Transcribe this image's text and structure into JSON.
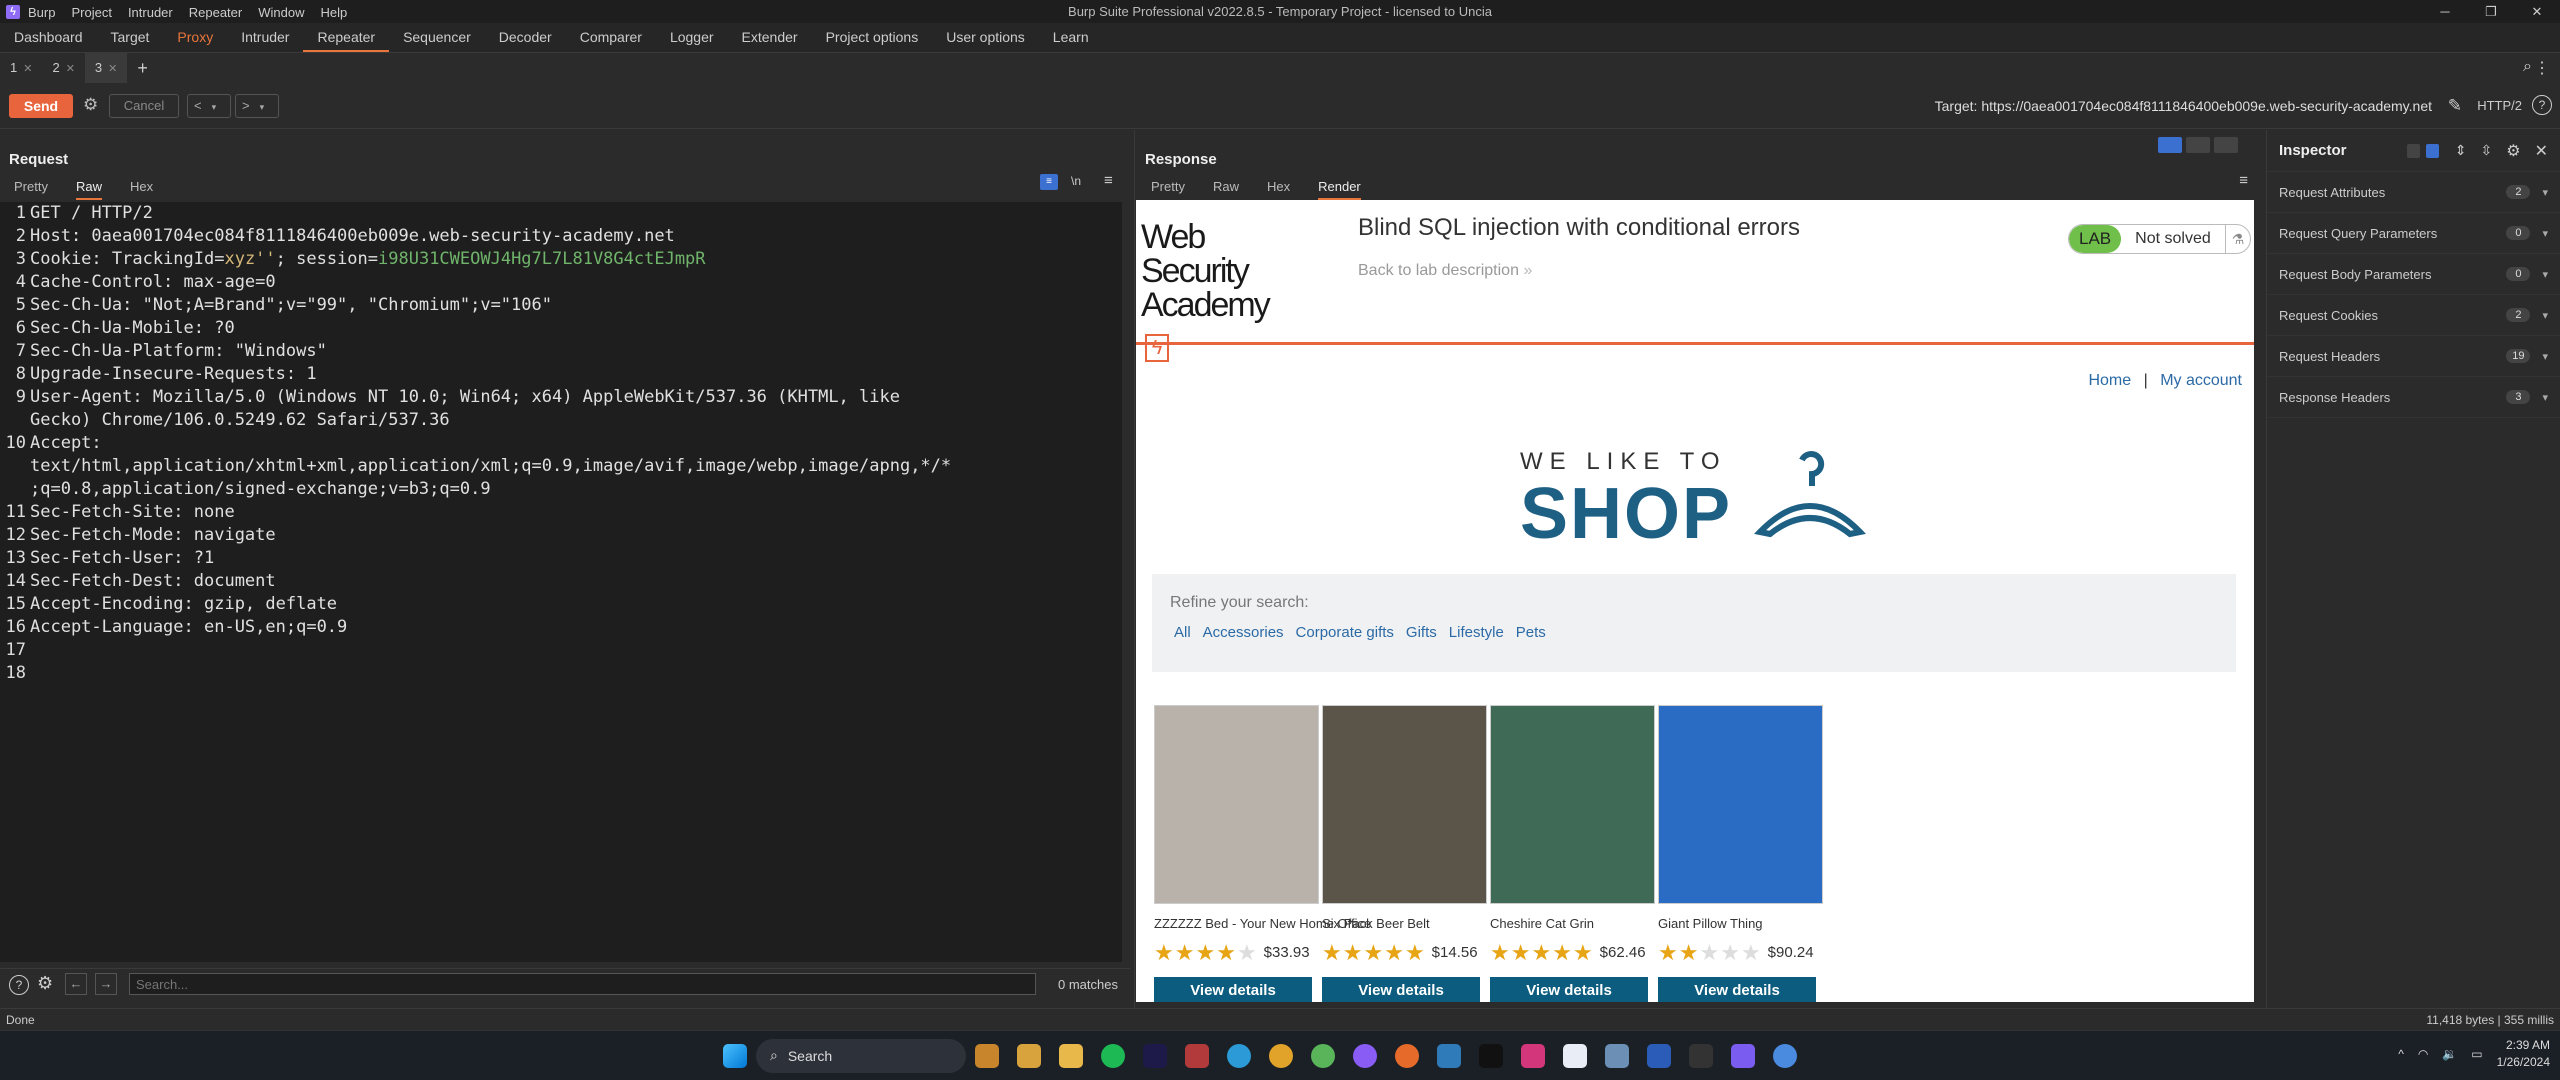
{
  "window": {
    "title": "Burp Suite Professional v2022.8.5 - Temporary Project - licensed to Uncia",
    "menu": [
      "Burp",
      "Project",
      "Intruder",
      "Repeater",
      "Window",
      "Help"
    ]
  },
  "tool_tabs": [
    "Dashboard",
    "Target",
    "Proxy",
    "Intruder",
    "Repeater",
    "Sequencer",
    "Decoder",
    "Comparer",
    "Logger",
    "Extender",
    "Project options",
    "User options",
    "Learn"
  ],
  "repeater_tabs": [
    {
      "label": "1"
    },
    {
      "label": "2"
    },
    {
      "label": "3"
    }
  ],
  "toolbar": {
    "send": "Send",
    "cancel": "Cancel",
    "back": "<",
    "forward": ">",
    "target": "Target: https://0aea001704ec084f8111846400eb009e.web-security-academy.net",
    "protocol": "HTTP/2"
  },
  "request": {
    "title": "Request",
    "tabs": [
      "Pretty",
      "Raw",
      "Hex"
    ],
    "newline_toggle": "\\n",
    "lines": [
      {
        "n": "1",
        "parts": [
          [
            "k",
            "GET / HTTP/2"
          ]
        ]
      },
      {
        "n": "2",
        "parts": [
          [
            "k",
            "Host: 0aea001704ec084f8111846400eb009e.web-security-academy.net"
          ]
        ]
      },
      {
        "n": "3",
        "parts": [
          [
            "k",
            "Cookie: TrackingId="
          ],
          [
            "hl",
            "xyz''"
          ],
          [
            "k",
            "; session="
          ],
          [
            "ck",
            "i98U31CWEOWJ4Hg7L7L81V8G4ctEJmpR"
          ]
        ]
      },
      {
        "n": "4",
        "parts": [
          [
            "k",
            "Cache-Control: max-age=0"
          ]
        ]
      },
      {
        "n": "5",
        "parts": [
          [
            "k",
            "Sec-Ch-Ua: \"Not;A=Brand\";v=\"99\", \"Chromium\";v=\"106\""
          ]
        ]
      },
      {
        "n": "6",
        "parts": [
          [
            "k",
            "Sec-Ch-Ua-Mobile: ?0"
          ]
        ]
      },
      {
        "n": "7",
        "parts": [
          [
            "k",
            "Sec-Ch-Ua-Platform: \"Windows\""
          ]
        ]
      },
      {
        "n": "8",
        "parts": [
          [
            "k",
            "Upgrade-Insecure-Requests: 1"
          ]
        ]
      },
      {
        "n": "9",
        "parts": [
          [
            "k",
            "User-Agent: Mozilla/5.0 (Windows NT 10.0; Win64; x64) AppleWebKit/537.36 (KHTML, like"
          ]
        ]
      },
      {
        "n": "",
        "parts": [
          [
            "k",
            "Gecko) Chrome/106.0.5249.62 Safari/537.36"
          ]
        ]
      },
      {
        "n": "10",
        "parts": [
          [
            "k",
            "Accept:"
          ]
        ]
      },
      {
        "n": "",
        "parts": [
          [
            "k",
            "text/html,application/xhtml+xml,application/xml;q=0.9,image/avif,image/webp,image/apng,*/*"
          ]
        ]
      },
      {
        "n": "",
        "parts": [
          [
            "k",
            ";q=0.8,application/signed-exchange;v=b3;q=0.9"
          ]
        ]
      },
      {
        "n": "11",
        "parts": [
          [
            "k",
            "Sec-Fetch-Site: none"
          ]
        ]
      },
      {
        "n": "12",
        "parts": [
          [
            "k",
            "Sec-Fetch-Mode: navigate"
          ]
        ]
      },
      {
        "n": "13",
        "parts": [
          [
            "k",
            "Sec-Fetch-User: ?1"
          ]
        ]
      },
      {
        "n": "14",
        "parts": [
          [
            "k",
            "Sec-Fetch-Dest: document"
          ]
        ]
      },
      {
        "n": "15",
        "parts": [
          [
            "k",
            "Accept-Encoding: gzip, deflate"
          ]
        ]
      },
      {
        "n": "16",
        "parts": [
          [
            "k",
            "Accept-Language: en-US,en;q=0.9"
          ]
        ]
      },
      {
        "n": "17",
        "parts": []
      },
      {
        "n": "18",
        "parts": []
      }
    ],
    "search_placeholder": "Search...",
    "matches": "0 matches"
  },
  "response": {
    "title": "Response",
    "tabs": [
      "Pretty",
      "Raw",
      "Hex",
      "Render"
    ]
  },
  "page": {
    "logo_line1": "Web Security",
    "logo_line2": "Academy",
    "lab_title": "Blind SQL injection with conditional errors",
    "back_link": "Back to lab description",
    "lab_badge": "LAB",
    "lab_status": "Not solved",
    "nav_home": "Home",
    "nav_sep": "|",
    "nav_account": "My account",
    "shop_top": "WE LIKE TO",
    "shop_big": "SHOP",
    "refine": "Refine your search:",
    "categories": [
      "All",
      "Accessories",
      "Corporate gifts",
      "Gifts",
      "Lifestyle",
      "Pets"
    ],
    "products": [
      {
        "name": "ZZZZZZ Bed - Your New Home Office",
        "rating": 4,
        "price": "$33.93",
        "button": "View details",
        "color": "#b8b2ab"
      },
      {
        "name": "Six Pack Beer Belt",
        "rating": 5,
        "price": "$14.56",
        "button": "View details",
        "color": "#5a5548"
      },
      {
        "name": "Cheshire Cat Grin",
        "rating": 5,
        "price": "$62.46",
        "button": "View details",
        "color": "#3f6a56"
      },
      {
        "name": "Giant Pillow Thing",
        "rating": 2,
        "price": "$90.24",
        "button": "View details",
        "color": "#2a6bc4"
      }
    ]
  },
  "inspector": {
    "title": "Inspector",
    "rows": [
      {
        "label": "Request Attributes",
        "count": "2"
      },
      {
        "label": "Request Query Parameters",
        "count": "0"
      },
      {
        "label": "Request Body Parameters",
        "count": "0"
      },
      {
        "label": "Request Cookies",
        "count": "2"
      },
      {
        "label": "Request Headers",
        "count": "19"
      },
      {
        "label": "Response Headers",
        "count": "3"
      }
    ]
  },
  "status": {
    "left": "Done",
    "right": "11,418 bytes | 355 millis"
  },
  "taskbar": {
    "search": "Search",
    "time": "2:39 AM",
    "date": "1/26/2024"
  }
}
